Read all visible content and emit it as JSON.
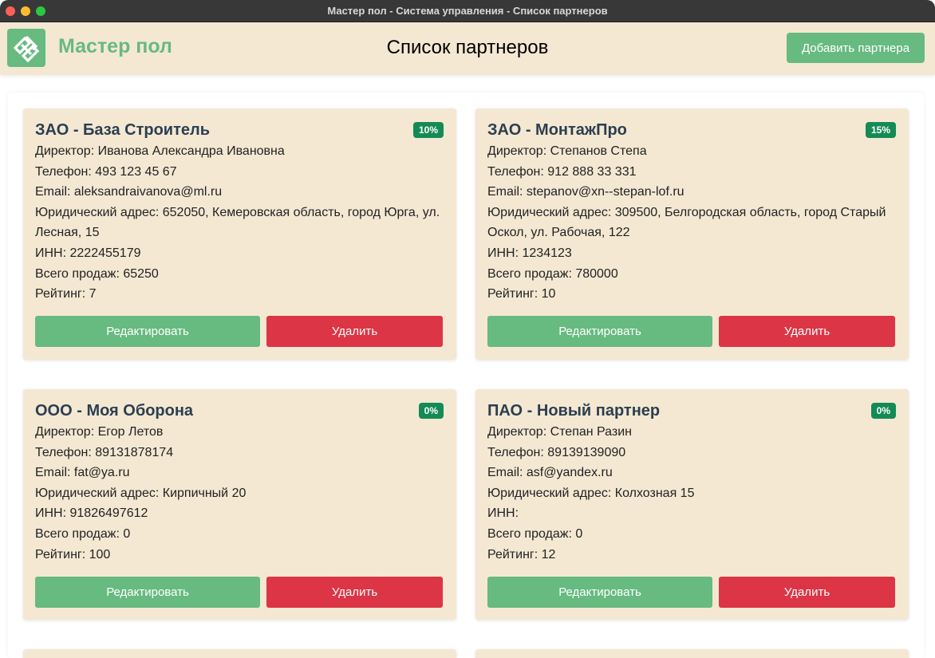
{
  "window": {
    "title": "Мастер пол - Система управления - Список партнеров"
  },
  "header": {
    "brand": "Мастер пол",
    "page_title": "Список партнеров",
    "add_button": "Добавить партнера"
  },
  "colors": {
    "accent": "#67ba80",
    "card_bg": "#f4e8d3",
    "danger": "#dc3545",
    "badge": "#148a55",
    "heading": "#2c3e50"
  },
  "partners": [
    {
      "name": "ЗАО - База Строитель",
      "discount": "10%",
      "director": "Директор: Иванова Александра Ивановна",
      "phone": "Телефон: 493 123 45 67",
      "email": "Email: aleksandraivanova@ml.ru",
      "address": "Юридический адрес: 652050, Кемеровская область, город Юрга, ул. Лесная, 15",
      "inn": "ИНН: 2222455179",
      "sales": "Всего продаж: 65250",
      "rating": "Рейтинг: 7",
      "edit_label": "Редактировать",
      "delete_label": "Удалить"
    },
    {
      "name": "ЗАО - МонтажПро",
      "discount": "15%",
      "director": "Директор: Степанов Степа",
      "phone": "Телефон: 912 888 33 331",
      "email": "Email: stepanov@xn--stepan-lof.ru",
      "address": "Юридический адрес: 309500, Белгородская область, город Старый Оскол, ул. Рабочая, 122",
      "inn": "ИНН: 1234123",
      "sales": "Всего продаж: 780000",
      "rating": "Рейтинг: 10",
      "edit_label": "Редактировать",
      "delete_label": "Удалить"
    },
    {
      "name": "ООО - Моя Оборона",
      "discount": "0%",
      "director": "Директор: Егор Летов",
      "phone": "Телефон: 89131878174",
      "email": "Email: fat@ya.ru",
      "address": "Юридический адрес: Кирпичный 20",
      "inn": "ИНН: 91826497612",
      "sales": "Всего продаж: 0",
      "rating": "Рейтинг: 100",
      "edit_label": "Редактировать",
      "delete_label": "Удалить"
    },
    {
      "name": "ПАО - Новый партнер",
      "discount": "0%",
      "director": "Директор: Степан Разин",
      "phone": "Телефон: 89139139090",
      "email": "Email: asf@yandex.ru",
      "address": "Юридический адрес: Колхозная 15",
      "inn": "ИНН:",
      "sales": "Всего продаж: 0",
      "rating": "Рейтинг: 12",
      "edit_label": "Редактировать",
      "delete_label": "Удалить"
    }
  ]
}
